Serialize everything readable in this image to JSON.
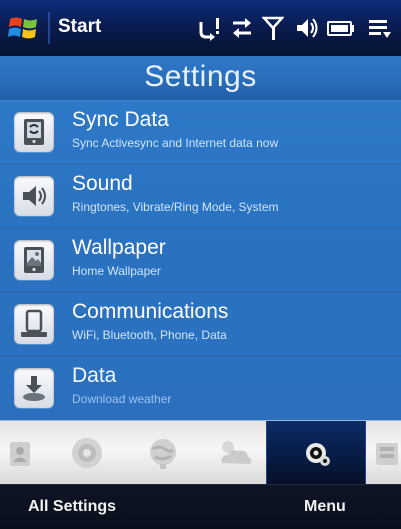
{
  "status_bar": {
    "start_label": "Start",
    "icons": [
      "windows-flag-icon",
      "sync-alert-icon",
      "data-connection-icon",
      "signal-strength-icon",
      "volume-icon",
      "battery-icon",
      "connections-menu-icon"
    ]
  },
  "header": {
    "title": "Settings"
  },
  "settings_list": {
    "items": [
      {
        "icon": "sync-data-icon",
        "title": "Sync Data",
        "subtitle": "Sync Activesync and Internet data now"
      },
      {
        "icon": "speaker-icon",
        "title": "Sound",
        "subtitle": "Ringtones, Vibrate/Ring Mode, System"
      },
      {
        "icon": "wallpaper-icon",
        "title": "Wallpaper",
        "subtitle": "Home Wallpaper"
      },
      {
        "icon": "communications-icon",
        "title": "Communications",
        "subtitle": "WiFi, Bluetooth, Phone, Data"
      },
      {
        "icon": "data-download-icon",
        "title": "Data",
        "subtitle": "Download weather"
      }
    ]
  },
  "tab_strip": {
    "tabs": [
      {
        "icon": "contacts-tab-icon",
        "active": false
      },
      {
        "icon": "messaging-tab-icon",
        "active": false
      },
      {
        "icon": "internet-tab-icon",
        "active": false
      },
      {
        "icon": "weather-tab-icon",
        "active": false
      },
      {
        "icon": "settings-tab-icon",
        "active": true
      },
      {
        "icon": "music-tab-icon",
        "active": false
      }
    ]
  },
  "softkeys": {
    "left": "All Settings",
    "right": "Menu"
  },
  "colors": {
    "status_bar": "#0a1b4e",
    "list_background": "#2a73c1",
    "title_text": "#e7f1ff",
    "subtitle_text": "#d2e6ff",
    "tab_active": "#071a42",
    "tab_strip": "#eeeeee"
  }
}
